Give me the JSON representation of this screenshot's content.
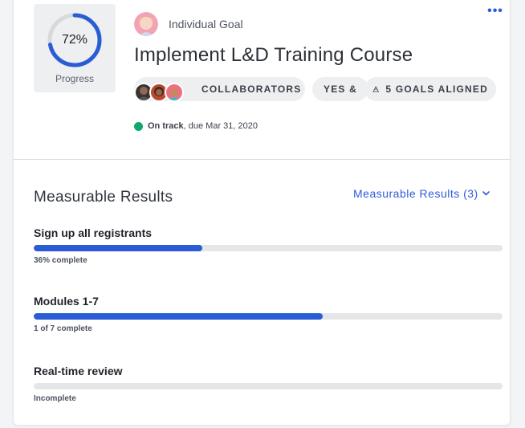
{
  "goal": {
    "progress_value": "72%",
    "progress_fraction": 0.72,
    "progress_label": "Progress",
    "type": "Individual Goal",
    "title": "Implement L&D Training Course",
    "more_icon": "more-horizontal-icon",
    "pills": {
      "collaborators": "COLLABORATORS",
      "yes_and": "YES &",
      "aligned": "5 GOALS ALIGNED"
    },
    "status": {
      "state": "On track",
      "due": ", due Mar 31, 2020",
      "color": "#10a86b"
    }
  },
  "results": {
    "section_title": "Measurable Results",
    "dropdown_label": "Measurable Results (3)",
    "items": [
      {
        "title": "Sign up all registrants",
        "progress": 0.36,
        "subtitle": "36% complete"
      },
      {
        "title": "Modules 1-7",
        "progress": 0.6163,
        "subtitle": "1 of 7 complete"
      },
      {
        "title": "Real-time review",
        "progress": 0,
        "subtitle": "Incomplete"
      }
    ]
  },
  "colors": {
    "accent": "#2f5bd8",
    "bar_fill": "#2a5cd6",
    "bar_track": "#e4e6e8",
    "on_track": "#10a86b"
  }
}
